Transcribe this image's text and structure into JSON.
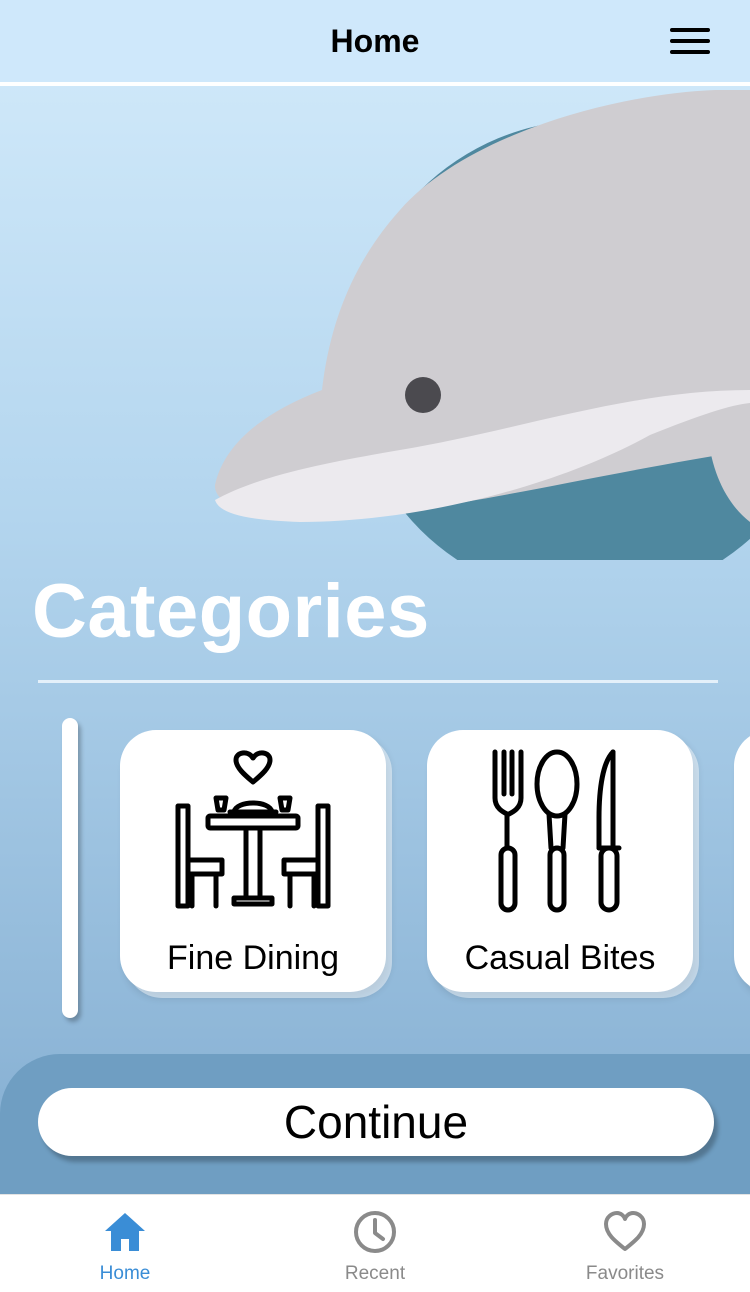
{
  "header": {
    "title": "Home",
    "menu_icon": "hamburger-menu-icon"
  },
  "hero": {
    "illustration": "dolphin"
  },
  "categories": {
    "title": "Categories",
    "items": [
      {
        "label": "Fine Dining",
        "icon": "dining-table-icon"
      },
      {
        "label": "Casual Bites",
        "icon": "fork-spoon-knife-icon"
      }
    ]
  },
  "actions": {
    "continue_label": "Continue"
  },
  "tabbar": {
    "tabs": [
      {
        "label": "Home",
        "icon": "home-icon",
        "active": true
      },
      {
        "label": "Recent",
        "icon": "clock-icon",
        "active": false
      },
      {
        "label": "Favorites",
        "icon": "heart-icon",
        "active": false
      }
    ]
  },
  "colors": {
    "accent": "#3a8dd6",
    "inactive": "#8a8a8a",
    "panel": "#6f9ec2",
    "header_bg": "#cfe8fb"
  }
}
